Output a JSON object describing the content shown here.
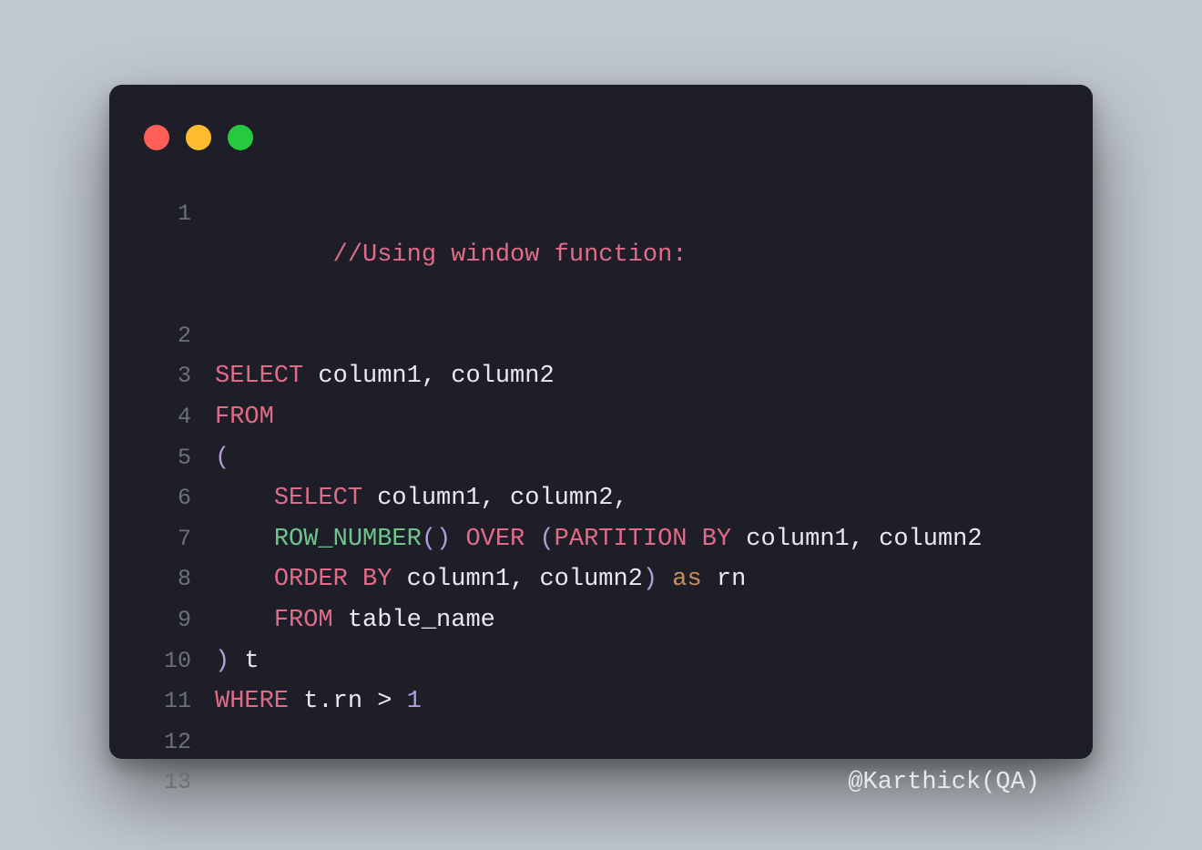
{
  "traffic_lights": {
    "red": "close",
    "yellow": "minimize",
    "green": "zoom"
  },
  "lines": {
    "l1": {
      "num": "1",
      "comment": "//Using window function:"
    },
    "l2": {
      "num": "2"
    },
    "l3": {
      "num": "3",
      "kw": "SELECT",
      "rest": " column1, column2"
    },
    "l4": {
      "num": "4",
      "kw": "FROM"
    },
    "l5": {
      "num": "5",
      "paren": "("
    },
    "l6": {
      "num": "6",
      "indent": "    ",
      "kw": "SELECT",
      "rest": " column1, column2,"
    },
    "l7": {
      "num": "7",
      "indent": "    ",
      "func": "ROW_NUMBER",
      "parenpair": "()",
      "sp": " ",
      "over": "OVER",
      "sp2": " ",
      "po": "(",
      "part": "PARTITION BY",
      "rest": " column1, column2"
    },
    "l8": {
      "num": "8",
      "indent": "    ",
      "kw": "ORDER BY",
      "mid": " column1, column2",
      "pc": ")",
      "sp": " ",
      "as": "as",
      "rn": " rn"
    },
    "l9": {
      "num": "9",
      "indent": "    ",
      "kw": "FROM",
      "rest": " table_name"
    },
    "l10": {
      "num": "10",
      "pc": ")",
      "rest": " t"
    },
    "l11": {
      "num": "11",
      "kw": "WHERE",
      "mid": " t.rn > ",
      "num2": "1"
    },
    "l12": {
      "num": "12"
    },
    "l13": {
      "num": "13",
      "credit": "@Karthick(QA)"
    }
  }
}
